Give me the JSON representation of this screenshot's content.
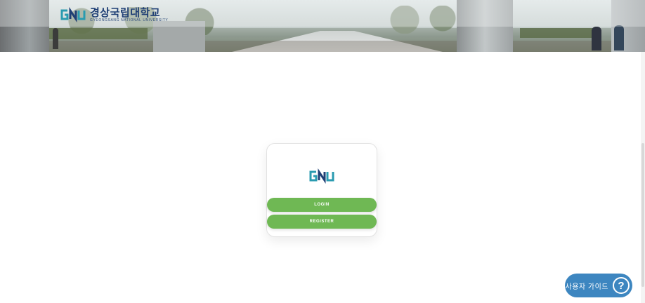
{
  "header": {
    "logo_mark": "GNU",
    "university_name_ko": "경상국립대학교",
    "university_name_en": "GYEONGSANG NATIONAL UNIVERSITY"
  },
  "card": {
    "logo_mark": "GNU",
    "login_label": "LOGIN",
    "register_label": "REGISTER"
  },
  "guide": {
    "label": "사용자 가이드",
    "icon_glyph": "?",
    "icon": "question-circle-icon"
  },
  "colors": {
    "accent_green": "#6fb854",
    "guide_blue": "#3d86c0",
    "logo_teal": "#2a9bb0",
    "logo_navy": "#1f3f75"
  }
}
